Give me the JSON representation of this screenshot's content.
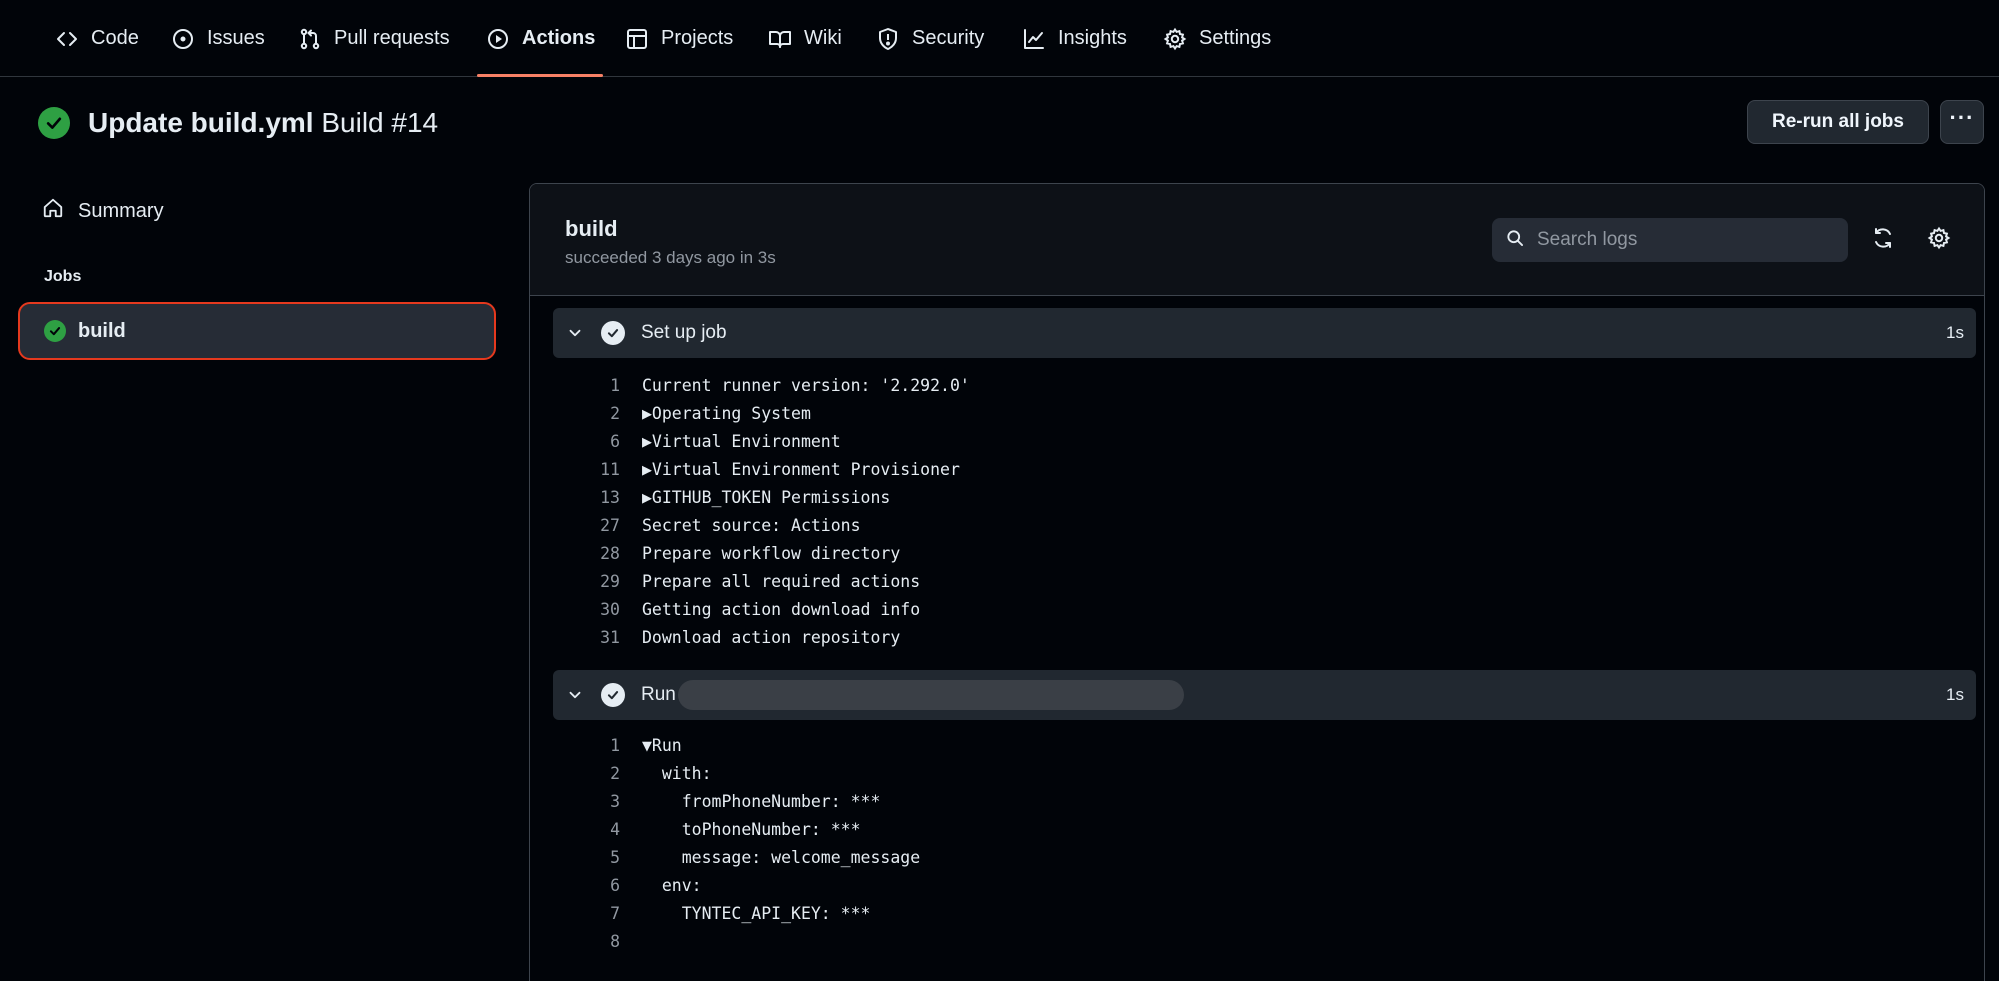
{
  "nav": {
    "tabs": [
      {
        "label": "Code",
        "icon": "code-icon"
      },
      {
        "label": "Issues",
        "icon": "issue-circle-icon"
      },
      {
        "label": "Pull requests",
        "icon": "pull-request-icon"
      },
      {
        "label": "Actions",
        "icon": "play-circle-icon",
        "active": true
      },
      {
        "label": "Projects",
        "icon": "table-icon"
      },
      {
        "label": "Wiki",
        "icon": "book-icon"
      },
      {
        "label": "Security",
        "icon": "shield-icon"
      },
      {
        "label": "Insights",
        "icon": "graph-icon"
      },
      {
        "label": "Settings",
        "icon": "gear-icon"
      }
    ]
  },
  "run": {
    "title_bold": "Update build.yml",
    "title_rest": " Build #14",
    "status": "success",
    "rerun_label": "Re-run all jobs",
    "more_label": "···"
  },
  "sidebar": {
    "summary_label": "Summary",
    "jobs_heading": "Jobs",
    "jobs": [
      {
        "label": "build",
        "status": "success",
        "selected": true
      }
    ]
  },
  "job": {
    "name": "build",
    "subtitle": "succeeded 3 days ago in 3s",
    "search_placeholder": "Search logs"
  },
  "steps": [
    {
      "name": "Set up job",
      "duration": "1s",
      "expanded": true,
      "lines": [
        {
          "n": "1",
          "text": "Current runner version: '2.292.0'"
        },
        {
          "n": "2",
          "text": "▶Operating System"
        },
        {
          "n": "6",
          "text": "▶Virtual Environment"
        },
        {
          "n": "11",
          "text": "▶Virtual Environment Provisioner"
        },
        {
          "n": "13",
          "text": "▶GITHUB_TOKEN Permissions"
        },
        {
          "n": "27",
          "text": "Secret source: Actions"
        },
        {
          "n": "28",
          "text": "Prepare workflow directory"
        },
        {
          "n": "29",
          "text": "Prepare all required actions"
        },
        {
          "n": "30",
          "text": "Getting action download info"
        },
        {
          "n": "31",
          "text": "Download action repository"
        }
      ]
    },
    {
      "name": "Run",
      "name_redacted": true,
      "duration": "1s",
      "expanded": true,
      "lines": [
        {
          "n": "1",
          "text": "▼Run"
        },
        {
          "n": "2",
          "text": "  with:"
        },
        {
          "n": "3",
          "text": "    fromPhoneNumber: ***"
        },
        {
          "n": "4",
          "text": "    toPhoneNumber: ***"
        },
        {
          "n": "5",
          "text": "    message: welcome_message"
        },
        {
          "n": "6",
          "text": "  env:"
        },
        {
          "n": "7",
          "text": "    TYNTEC_API_KEY: ***"
        },
        {
          "n": "8",
          "text": ""
        }
      ]
    }
  ],
  "colors": {
    "background": "#010409",
    "success": "#2ea043",
    "active_tab_underline": "#f78166",
    "selection_outline": "#e5391e"
  }
}
